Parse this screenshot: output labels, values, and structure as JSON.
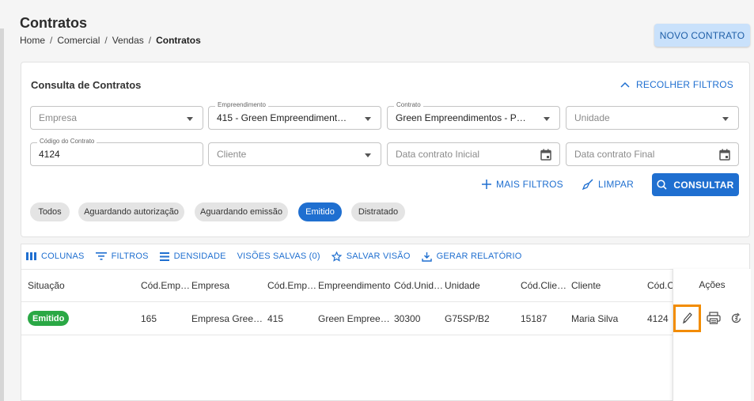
{
  "header": {
    "title": "Contratos",
    "breadcrumb": [
      "Home",
      "Comercial",
      "Vendas",
      "Contratos"
    ],
    "new_button": "NOVO CONTRATO"
  },
  "filters": {
    "title": "Consulta de Contratos",
    "collapse_label": "RECOLHER FILTROS",
    "empresa": {
      "placeholder": "Empresa"
    },
    "empreendimento": {
      "label": "Empreendimento",
      "value": "415 - Green Empreendiment…"
    },
    "contrato": {
      "label": "Contrato",
      "value": "Green Empreendimentos - P…"
    },
    "unidade": {
      "placeholder": "Unidade"
    },
    "codigo": {
      "label": "Código do Contrato",
      "value": "4124"
    },
    "cliente": {
      "placeholder": "Cliente"
    },
    "data_inicial": {
      "placeholder": "Data contrato Inicial"
    },
    "data_final": {
      "placeholder": "Data contrato Final"
    },
    "more_filters": "MAIS FILTROS",
    "clear": "LIMPAR",
    "search": "CONSULTAR",
    "chips": [
      "Todos",
      "Aguardando autorização",
      "Aguardando emissão",
      "Emitido",
      "Distratado"
    ],
    "active_chip": "Emitido"
  },
  "toolbar": {
    "columns": "COLUNAS",
    "filters": "FILTROS",
    "density": "DENSIDADE",
    "saved_views": "VISÕES SALVAS (0)",
    "save_view": "SALVAR VISÃO",
    "report": "GERAR RELATÓRIO"
  },
  "table": {
    "headers": [
      "Situação",
      "Cód.Emp…",
      "Empresa",
      "Cód.Emp…",
      "Empreendimento",
      "Cód.Unid…",
      "Unidade",
      "Cód.Clie…",
      "Cliente",
      "Cód.Co",
      "Ações"
    ],
    "rows": [
      {
        "status": "Emitido",
        "cod_empresa": "165",
        "empresa": "Empresa Gree…",
        "cod_emp": "415",
        "empreendimento": "Green Empree…",
        "cod_unidade": "30300",
        "unidade": "G75SP/B2",
        "cod_cliente": "15187",
        "cliente": "Maria Silva",
        "cod_contrato": "4124"
      }
    ]
  },
  "colors": {
    "primary": "#1f6fd0",
    "success": "#2aa845",
    "highlight": "#f28c00"
  }
}
